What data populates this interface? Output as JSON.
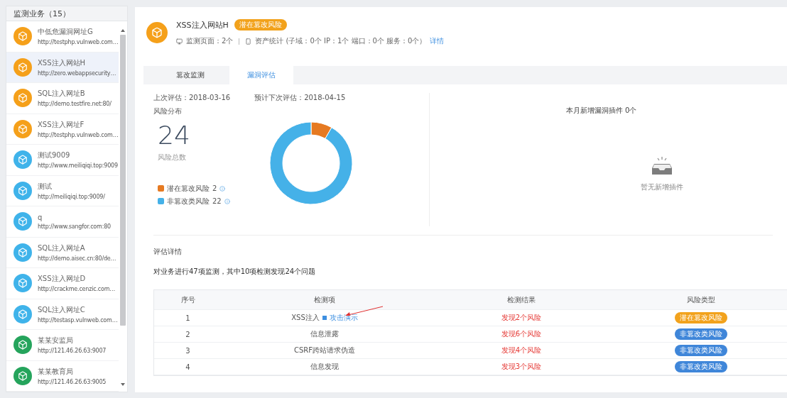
{
  "sidebar": {
    "title": "监测业务（15）",
    "items": [
      {
        "name": "中低危漏洞网址G",
        "url": "http://testphp.vulnweb.com…",
        "color": "#f5a01a",
        "selected": false
      },
      {
        "name": "XSS注入网站H",
        "url": "http://zero.webappsecurity…",
        "color": "#f5a01a",
        "selected": true
      },
      {
        "name": "SQL注入网址B",
        "url": "http://demo.testfire.net:80/",
        "color": "#f5a01a",
        "selected": false
      },
      {
        "name": "XSS注入网址F",
        "url": "http://testphp.vulnweb.com…",
        "color": "#f5a01a",
        "selected": false
      },
      {
        "name": "测试9009",
        "url": "http://www.meiliqiqi.top:9009",
        "color": "#3fb3ea",
        "selected": false
      },
      {
        "name": "测试",
        "url": "http://meiliqiqi.top:9009/",
        "color": "#3fb3ea",
        "selected": false
      },
      {
        "name": "q",
        "url": "http://www.sangfor.com:80",
        "color": "#3fb3ea",
        "selected": false
      },
      {
        "name": "SQL注入网址A",
        "url": "http://demo.aisec.cn:80/de…",
        "color": "#3fb3ea",
        "selected": false
      },
      {
        "name": "XSS注入网址D",
        "url": "http://crackme.cenzic.com…",
        "color": "#3fb3ea",
        "selected": false
      },
      {
        "name": "SQL注入网址C",
        "url": "http://testasp.vulnweb.com…",
        "color": "#3fb3ea",
        "selected": false
      },
      {
        "name": "某某安监局",
        "url": "http://121.46.26.63:9007",
        "color": "#25a45c",
        "selected": false
      },
      {
        "name": "某某教育局",
        "url": "http://121.46.26.63:9005",
        "color": "#25a45c",
        "selected": false
      }
    ]
  },
  "site": {
    "title": "XSS注入网站H",
    "badge": "潜在篡改风险",
    "pages": "监测页面：2个",
    "assets": "资产统计 (子域：0个   IP：1个   端口：0个   服务：0个）",
    "details_link": "详情"
  },
  "tabs": [
    {
      "label": "篡改监测",
      "selected": false
    },
    {
      "label": "漏洞评估",
      "selected": true
    }
  ],
  "dates": {
    "last": "上次评估：2018-03-16",
    "next": "预计下次评估：2018-04-15"
  },
  "risk": {
    "total": "24",
    "total_label": "风险总数",
    "legend": [
      {
        "count": "2",
        "color": "#e67a22"
      },
      {
        "count": "22",
        "color": "#45b1e8"
      }
    ],
    "chart_data": {
      "type": "donut",
      "categories": [
        "潜在篡改风险",
        "非篡改类风险"
      ],
      "series": [
        {
          "name": "风险分布",
          "values": [
            8.3,
            91.7
          ]
        }
      ]
    }
  },
  "plugins": {
    "title": "本月新增漏洞插件 0个",
    "empty_text": "暂无新增插件"
  },
  "details": {
    "title": "评估详情",
    "summary": "对业务进行47项监测，其中10项检测发现24个问题"
  },
  "table": {
    "columns": [
      "序号",
      "检测项",
      "检测结果",
      "风险类型"
    ],
    "rows": [
      {
        "no": "1",
        "item": "XSS注入",
        "demo_link": "攻击演示",
        "result": "发现2个风险",
        "risk": "潜在篡改风险",
        "kind": "potential"
      },
      {
        "no": "2",
        "item": "信息泄露",
        "result": "发现6个风险",
        "risk": "非篡改类风险",
        "kind": "other"
      },
      {
        "no": "3",
        "item": "CSRF跨站请求伪造",
        "result": "发现4个风险",
        "risk": "非篡改类风险",
        "kind": "other"
      },
      {
        "no": "4",
        "item": "信息发现",
        "result": "发现3个风险",
        "risk": "非篡改类风险",
        "kind": "other"
      }
    ]
  }
}
